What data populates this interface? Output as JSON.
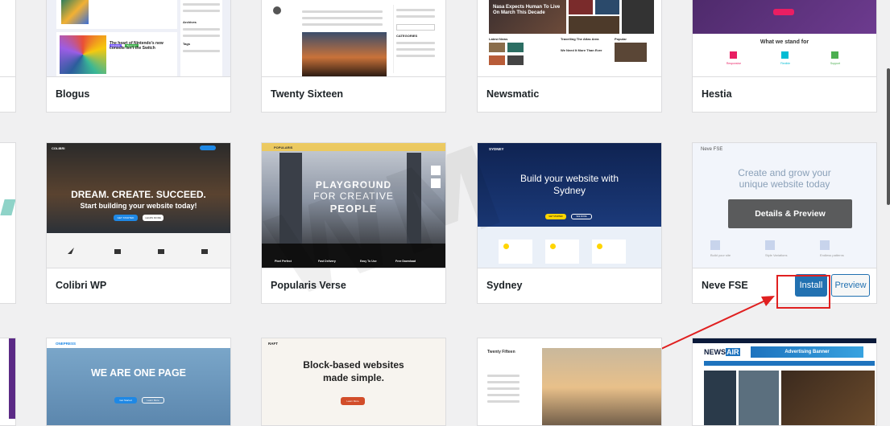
{
  "themes": {
    "blogus": {
      "name": "Blogus",
      "post_title": "The heart of Nintendo's new console isn't the Switch",
      "tags": [
        "Lifestyle",
        "Business"
      ],
      "sidebar_heading": "Archives",
      "tags_heading": "Tags"
    },
    "twenty_sixteen": {
      "name": "Twenty Sixteen",
      "categories_heading": "CATEGORIES"
    },
    "newsmatic": {
      "name": "Newsmatic",
      "hero_headline": "Nasa Expects Human To Live On March This Decade",
      "latest_news": "Latest News",
      "popular": "Popular",
      "side_headline_1": "Travelling The Atlas Area",
      "side_headline_2": "We Need It More Than Ever"
    },
    "hestia": {
      "name": "Hestia",
      "section_title": "What we stand for",
      "features": [
        "Responsive",
        "Flexible",
        "Support"
      ]
    },
    "colibri": {
      "name": "Colibri WP",
      "brand": "COLIBRI",
      "headline": "DREAM. CREATE. SUCCEED.",
      "subheadline": "Start building your website today!",
      "cta_primary": "GET STARTED",
      "cta_secondary": "LEARN MORE"
    },
    "popularis": {
      "name": "Popularis Verse",
      "brand": "POPULARIS",
      "headline_1": "PLAYGROUND",
      "headline_2": "FOR CREATIVE",
      "headline_3": "PEOPLE",
      "features": [
        "Pixel Perfect",
        "Fast Delivery",
        "Easy To Use",
        "Free Download"
      ]
    },
    "sydney": {
      "name": "Sydney",
      "brand": "SYDNEY",
      "headline": "Build your website with Sydney",
      "cta_primary": "GET STARTED",
      "cta_secondary": "SEE MORE"
    },
    "neve_fse": {
      "name": "Neve FSE",
      "brand": "Neve FSE",
      "headline": "Create and grow your unique website today",
      "details_preview": "Details & Preview",
      "install": "Install",
      "preview": "Preview",
      "features": [
        "Build your site",
        "Style Variations",
        "Endless patterns"
      ]
    },
    "onepress": {
      "brand": "ONEPRESS",
      "headline": "WE ARE ONE PAGE",
      "btn_1": "Get Started",
      "btn_2": "Learn More"
    },
    "raft": {
      "brand": "RAFT",
      "headline": "Block-based websites made simple.",
      "cta": "Learn More"
    },
    "twenty_fifteen": {
      "brand": "Twenty Fifteen"
    },
    "newsair": {
      "brand": "NEWS",
      "brand_accent": "AIR",
      "banner": "Advertising Banner"
    }
  },
  "colors": {
    "accent_blue": "#2271b1",
    "annotation_red": "#e02020"
  }
}
